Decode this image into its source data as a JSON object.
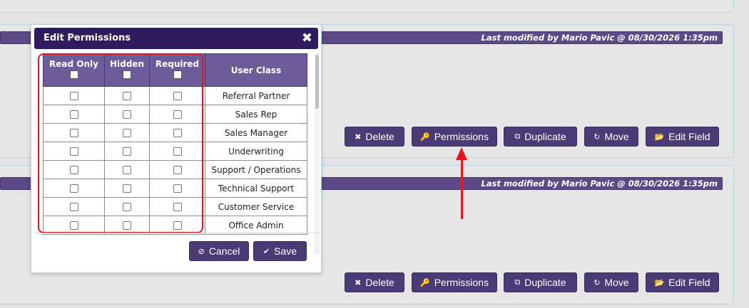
{
  "sections": [
    {
      "modified": "Last modified by Mario Pavic @ 08/30/2026 1:35pm",
      "buttons": [
        {
          "label": "Delete",
          "icon": "✖"
        },
        {
          "label": "Permissions",
          "icon": "🔑"
        },
        {
          "label": "Duplicate",
          "icon": "⧉"
        },
        {
          "label": "Move",
          "icon": "↻"
        },
        {
          "label": "Edit Field",
          "icon": "📂"
        }
      ]
    },
    {
      "modified": "Last modified by Mario Pavic @ 08/30/2026 1:35pm",
      "buttons": [
        {
          "label": "Delete",
          "icon": "✖"
        },
        {
          "label": "Permissions",
          "icon": "🔑"
        },
        {
          "label": "Duplicate",
          "icon": "⧉"
        },
        {
          "label": "Move",
          "icon": "↻"
        },
        {
          "label": "Edit Field",
          "icon": "📂"
        }
      ]
    }
  ],
  "modal": {
    "title": "Edit Permissions",
    "close": "✖",
    "columns": [
      "Read Only",
      "Hidden",
      "Required",
      "User Class"
    ],
    "rows": [
      "Referral Partner",
      "Sales Rep",
      "Sales Manager",
      "Underwriting",
      "Support / Operations",
      "Technical Support",
      "Customer Service",
      "Office Admin"
    ],
    "cancel_label": "Cancel",
    "save_label": "Save",
    "cancel_icon": "⊘",
    "save_icon": "✔"
  },
  "colors": {
    "accent": "#4a3a75",
    "title_bar": "#2f1b5e",
    "header": "#6d5c9a",
    "highlight": "#e0141e"
  }
}
